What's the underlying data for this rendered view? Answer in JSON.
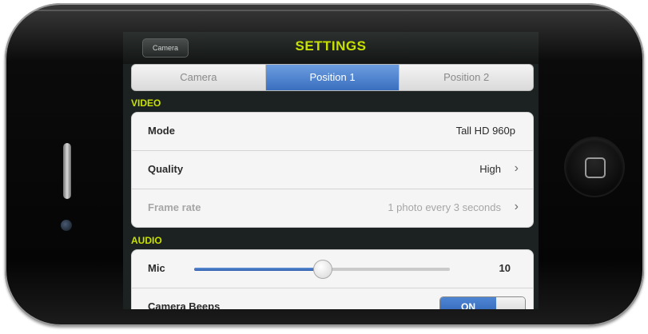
{
  "nav": {
    "back_label": "Camera",
    "title": "SETTINGS"
  },
  "tabs": [
    {
      "label": "Camera",
      "active": false
    },
    {
      "label": "Position 1",
      "active": true
    },
    {
      "label": "Position 2",
      "active": false
    }
  ],
  "sections": {
    "video": {
      "header": "VIDEO",
      "rows": [
        {
          "label": "Mode",
          "value": "Tall HD 960p",
          "chevron": false
        },
        {
          "label": "Quality",
          "value": "High",
          "chevron": true
        },
        {
          "label": "Frame rate",
          "value": "1 photo every 3 seconds",
          "chevron": true,
          "dimmed": true
        }
      ]
    },
    "audio": {
      "header": "AUDIO",
      "mic": {
        "label": "Mic",
        "value": "10",
        "level_fraction": 0.5
      },
      "camera_beeps": {
        "label": "Camera Beeps",
        "toggle": "ON"
      }
    }
  },
  "icons": {
    "chevron": "chevron-right-icon",
    "home": "home-button-icon"
  },
  "colors": {
    "title_accent": "#c8e000",
    "active_tab": "#3a6fbf",
    "screen_bg": "#1c2222"
  }
}
